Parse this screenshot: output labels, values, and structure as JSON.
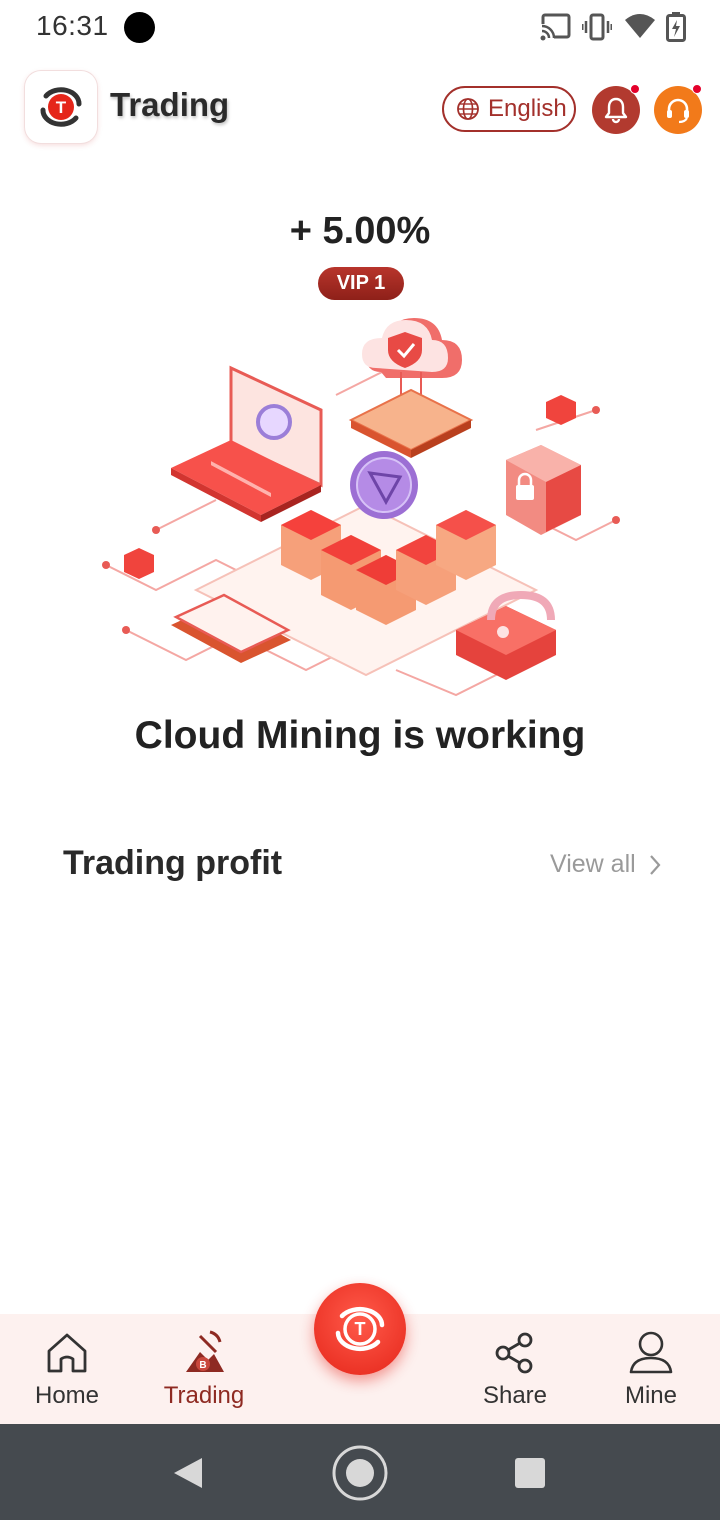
{
  "status_bar": {
    "time": "16:31",
    "icons": [
      "cast-icon",
      "vibrate-icon",
      "wifi-icon",
      "battery-icon"
    ]
  },
  "header": {
    "title": "Trading",
    "language_label": "English",
    "icons": [
      "app-logo",
      "globe-icon",
      "bell-icon",
      "headset-icon"
    ]
  },
  "rate": {
    "value": "+ 5.00%",
    "vip_label": "VIP 1"
  },
  "mining": {
    "status_text": "Cloud Mining is working"
  },
  "profit_section": {
    "title": "Trading profit",
    "view_all_label": "View all"
  },
  "bottom_nav": {
    "items": [
      {
        "label": "Home",
        "icon": "home-icon"
      },
      {
        "label": "Trading",
        "icon": "mining-icon"
      },
      {
        "label": "Share",
        "icon": "share-icon"
      },
      {
        "label": "Mine",
        "icon": "person-icon"
      }
    ],
    "active": "Trading",
    "center_icon": "app-logo"
  },
  "colors": {
    "brand_dark": "#a3302b",
    "brand_red": "#e5261a",
    "accent_orange": "#f27a1a",
    "nav_bg": "#fdf1ef",
    "system_nav_bg": "#454a4f"
  }
}
